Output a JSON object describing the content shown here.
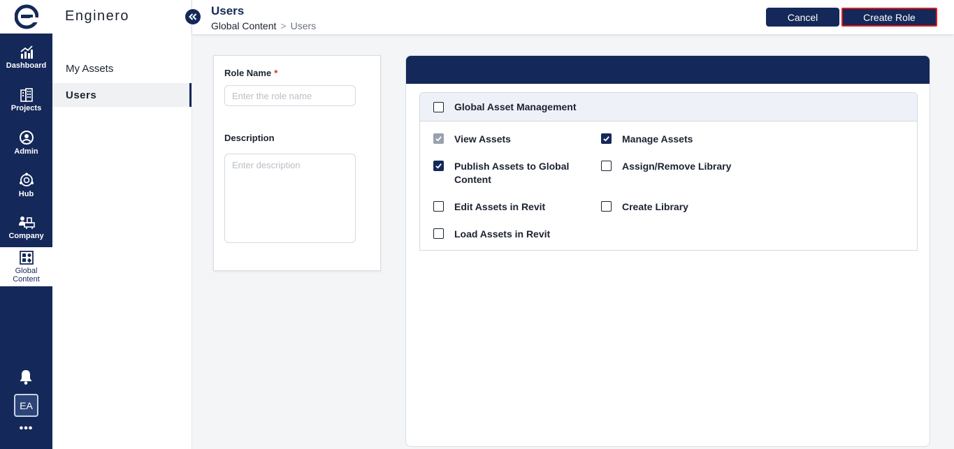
{
  "app": {
    "brand": "Enginero"
  },
  "rail": {
    "items": [
      {
        "label": "Dashboard",
        "icon": "chart-icon"
      },
      {
        "label": "Projects",
        "icon": "building-icon"
      },
      {
        "label": "Admin",
        "icon": "admin-icon"
      },
      {
        "label": "Hub",
        "icon": "hub-icon"
      },
      {
        "label": "Company",
        "icon": "company-icon"
      },
      {
        "label": "Global Content",
        "icon": "global-content-icon"
      }
    ],
    "avatar_initials": "EA",
    "more": "•••"
  },
  "sidebar": {
    "items": [
      {
        "label": "My Assets"
      },
      {
        "label": "Users"
      }
    ]
  },
  "header": {
    "title": "Users",
    "breadcrumb": [
      "Global Content",
      "Users"
    ],
    "separator": ">",
    "cancel_label": "Cancel",
    "create_label": "Create Role"
  },
  "form": {
    "role_name_label": "Role Name",
    "required_mark": "*",
    "role_name_placeholder": "Enter the role name",
    "description_label": "Description",
    "description_placeholder": "Enter description"
  },
  "permissions": {
    "group_title": "Global Asset Management",
    "group_checked": false,
    "items": [
      {
        "label": "View Assets",
        "state": "checked-disabled"
      },
      {
        "label": "Manage Assets",
        "state": "checked"
      },
      {
        "label": "Publish Assets to Global Content",
        "state": "checked"
      },
      {
        "label": "Assign/Remove Library",
        "state": "unchecked"
      },
      {
        "label": "Edit Assets in Revit",
        "state": "unchecked"
      },
      {
        "label": "Create Library",
        "state": "unchecked"
      },
      {
        "label": "Load Assets in Revit",
        "state": "unchecked"
      }
    ]
  },
  "colors": {
    "navy": "#142859",
    "highlight_border": "#e21b1b",
    "required": "#d62b2b"
  }
}
